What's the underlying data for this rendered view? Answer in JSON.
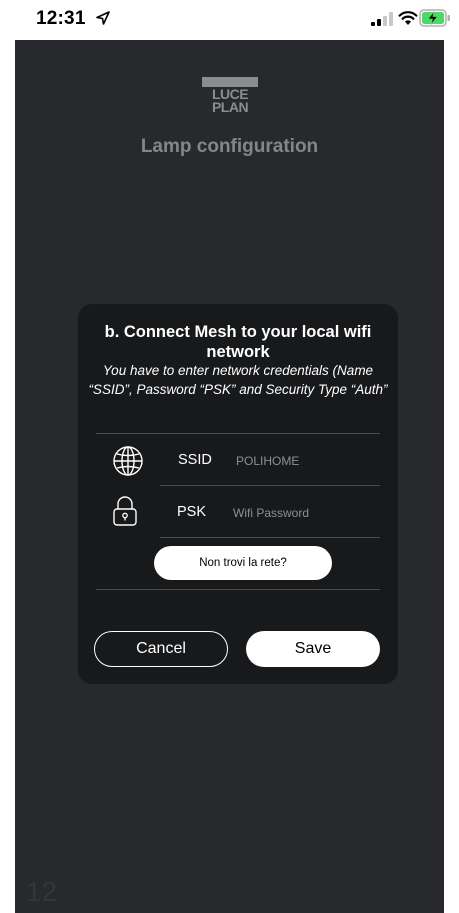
{
  "status_bar": {
    "time": "12:31",
    "icons": [
      "location-arrow-icon",
      "cellular-signal-icon",
      "wifi-icon",
      "battery-charging-icon"
    ]
  },
  "header": {
    "logo_lines": [
      "LUCE",
      "PLAN"
    ],
    "title": "Lamp configuration"
  },
  "dialog": {
    "title": "b. Connect Mesh to your local wifi network",
    "description": "You have to enter network credentials (Name “SSID”, Password “PSK” and Security Type “Auth”",
    "fields": [
      {
        "label": "SSID",
        "placeholder": "POLIHOME",
        "icon": "globe-icon"
      },
      {
        "label": "PSK",
        "placeholder": "Wifi Password",
        "icon": "lock-icon"
      }
    ],
    "network_help_label": "Non trovi la rete?",
    "cancel_label": "Cancel",
    "save_label": "Save"
  },
  "page_number": "12",
  "colors": {
    "screen_background": "#28292d",
    "dialog_background": "#18191b",
    "logo": "#8b8c90",
    "title": "#85868a",
    "battery_charging": "#4cd964"
  }
}
